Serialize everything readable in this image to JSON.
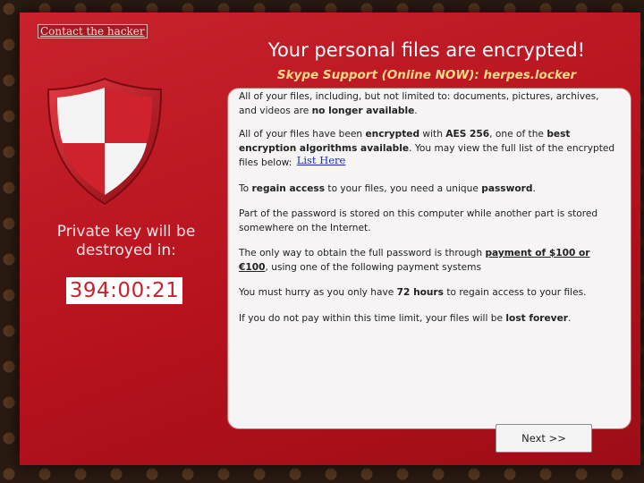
{
  "contact_link": "Contact the hacker",
  "title": "Your personal files are encrypted!",
  "subtitle": "Skype Support (Online NOW): herpes.locker",
  "countdown": {
    "label": "Private key will be destroyed in:",
    "timer": "394:00:21"
  },
  "message": {
    "p1_a": "All of your files, including, but not limited to: documents, pictures, archives, and videos are ",
    "p1_b": "no longer available",
    "p1_c": ".",
    "p2_a": "All of your files have been ",
    "p2_b": "encrypted",
    "p2_c": " with ",
    "p2_d": "AES 256",
    "p2_e": ", one of the ",
    "p2_f": "best encryption algorithms available",
    "p2_g": ". You may view the full list of the encrypted files below: ",
    "list_link": "List Here",
    "p3_a": "To ",
    "p3_b": "regain access",
    "p3_c": " to your files, you need a unique ",
    "p3_d": "password",
    "p3_e": ".",
    "p4": "Part of the password is stored on this computer while another part is stored somewhere on the Internet.",
    "p5_a": "The only way to obtain the full password is through ",
    "p5_b": "payment of $100 or €100",
    "p5_c": ", using one of the following payment systems",
    "p6_a": "You must hurry as you only have ",
    "p6_b": "72 hours",
    "p6_c": " to regain access to your files.",
    "p7_a": "If you do not pay within this time limit, your files will be ",
    "p7_b": "lost forever",
    "p7_c": "."
  },
  "next_button": "Next >>",
  "colors": {
    "window_red": "#c8232d",
    "subtitle_yellow": "#ffd98a",
    "link_blue": "#1a2bd6"
  },
  "icons": {
    "shield": "shield-icon"
  }
}
